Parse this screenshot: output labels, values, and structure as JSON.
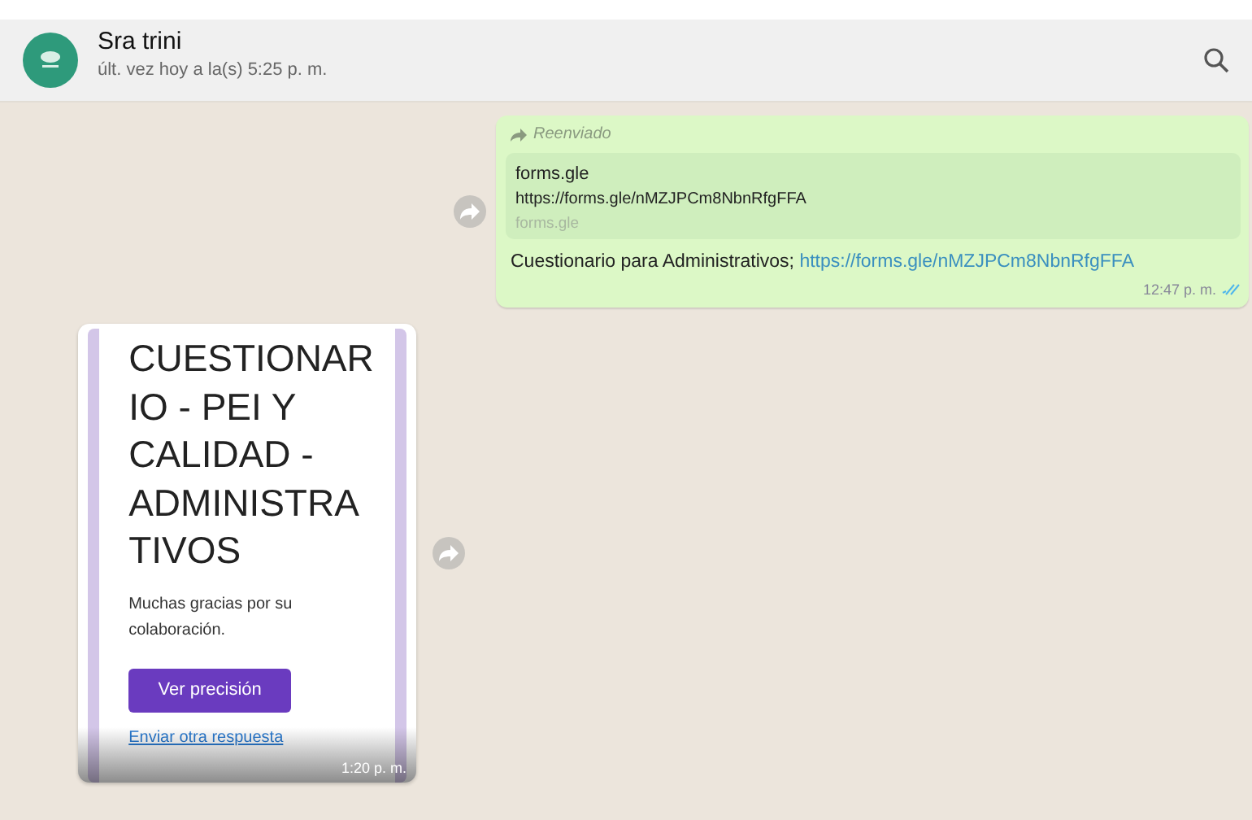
{
  "header": {
    "contact_name": "Sra trini",
    "last_seen": "últ. vez hoy a la(s) 5:25 p. m."
  },
  "messages": [
    {
      "kind": "link",
      "outgoing": true,
      "forwarded_label": "Reenviado",
      "preview": {
        "title": "forms.gle",
        "url": "https://forms.gle/nMZJPCm8NbnRfgFFA",
        "domain": "forms.gle"
      },
      "text": "Cuestionario para Administrativos;",
      "link": "https://forms.gle/nMZJPCm8NbnRfgFFA",
      "time": "12:47 p. m.",
      "read": true
    },
    {
      "kind": "image",
      "outgoing": false,
      "form": {
        "title_lines": [
          "CUESTIONAR",
          "IO - PEI Y",
          "CALIDAD -",
          "ADMINISTRA",
          "TIVOS"
        ],
        "thanks": "Muchas gracias por su colaboración.",
        "button": "Ver precisión",
        "link": "Enviar otra respuesta"
      },
      "time": "1:20 p. m."
    }
  ]
}
